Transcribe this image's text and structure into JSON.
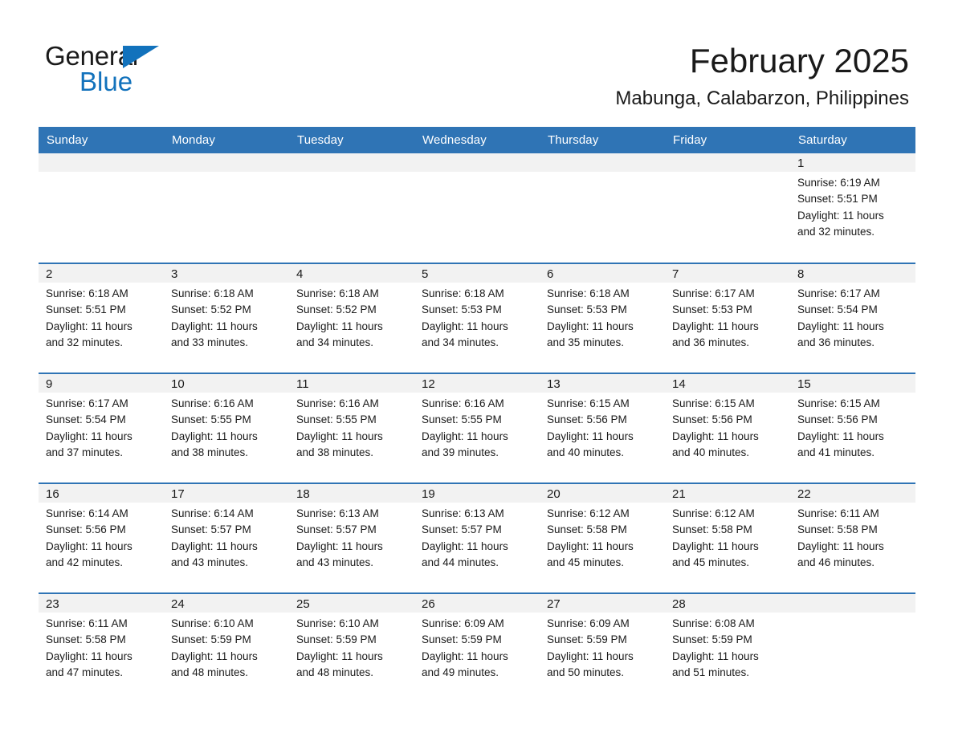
{
  "brand": {
    "word_one": "General",
    "word_two": "Blue",
    "accent_color": "#1272bc",
    "triangle_icon": "triangle-icon"
  },
  "header": {
    "title": "February 2025",
    "subtitle": "Mabunga, Calabarzon, Philippines"
  },
  "theme": {
    "header_blue": "#2f74b5",
    "daynum_band": "#f2f2f2",
    "text": "#1a1a1a"
  },
  "weekdays": [
    "Sunday",
    "Monday",
    "Tuesday",
    "Wednesday",
    "Thursday",
    "Friday",
    "Saturday"
  ],
  "weeks": [
    [
      {
        "day": "",
        "empty": true
      },
      {
        "day": "",
        "empty": true
      },
      {
        "day": "",
        "empty": true
      },
      {
        "day": "",
        "empty": true
      },
      {
        "day": "",
        "empty": true
      },
      {
        "day": "",
        "empty": true
      },
      {
        "day": "1",
        "sunrise": "Sunrise: 6:19 AM",
        "sunset": "Sunset: 5:51 PM",
        "daylight_line1": "Daylight: 11 hours",
        "daylight_line2": "and 32 minutes."
      }
    ],
    [
      {
        "day": "2",
        "sunrise": "Sunrise: 6:18 AM",
        "sunset": "Sunset: 5:51 PM",
        "daylight_line1": "Daylight: 11 hours",
        "daylight_line2": "and 32 minutes."
      },
      {
        "day": "3",
        "sunrise": "Sunrise: 6:18 AM",
        "sunset": "Sunset: 5:52 PM",
        "daylight_line1": "Daylight: 11 hours",
        "daylight_line2": "and 33 minutes."
      },
      {
        "day": "4",
        "sunrise": "Sunrise: 6:18 AM",
        "sunset": "Sunset: 5:52 PM",
        "daylight_line1": "Daylight: 11 hours",
        "daylight_line2": "and 34 minutes."
      },
      {
        "day": "5",
        "sunrise": "Sunrise: 6:18 AM",
        "sunset": "Sunset: 5:53 PM",
        "daylight_line1": "Daylight: 11 hours",
        "daylight_line2": "and 34 minutes."
      },
      {
        "day": "6",
        "sunrise": "Sunrise: 6:18 AM",
        "sunset": "Sunset: 5:53 PM",
        "daylight_line1": "Daylight: 11 hours",
        "daylight_line2": "and 35 minutes."
      },
      {
        "day": "7",
        "sunrise": "Sunrise: 6:17 AM",
        "sunset": "Sunset: 5:53 PM",
        "daylight_line1": "Daylight: 11 hours",
        "daylight_line2": "and 36 minutes."
      },
      {
        "day": "8",
        "sunrise": "Sunrise: 6:17 AM",
        "sunset": "Sunset: 5:54 PM",
        "daylight_line1": "Daylight: 11 hours",
        "daylight_line2": "and 36 minutes."
      }
    ],
    [
      {
        "day": "9",
        "sunrise": "Sunrise: 6:17 AM",
        "sunset": "Sunset: 5:54 PM",
        "daylight_line1": "Daylight: 11 hours",
        "daylight_line2": "and 37 minutes."
      },
      {
        "day": "10",
        "sunrise": "Sunrise: 6:16 AM",
        "sunset": "Sunset: 5:55 PM",
        "daylight_line1": "Daylight: 11 hours",
        "daylight_line2": "and 38 minutes."
      },
      {
        "day": "11",
        "sunrise": "Sunrise: 6:16 AM",
        "sunset": "Sunset: 5:55 PM",
        "daylight_line1": "Daylight: 11 hours",
        "daylight_line2": "and 38 minutes."
      },
      {
        "day": "12",
        "sunrise": "Sunrise: 6:16 AM",
        "sunset": "Sunset: 5:55 PM",
        "daylight_line1": "Daylight: 11 hours",
        "daylight_line2": "and 39 minutes."
      },
      {
        "day": "13",
        "sunrise": "Sunrise: 6:15 AM",
        "sunset": "Sunset: 5:56 PM",
        "daylight_line1": "Daylight: 11 hours",
        "daylight_line2": "and 40 minutes."
      },
      {
        "day": "14",
        "sunrise": "Sunrise: 6:15 AM",
        "sunset": "Sunset: 5:56 PM",
        "daylight_line1": "Daylight: 11 hours",
        "daylight_line2": "and 40 minutes."
      },
      {
        "day": "15",
        "sunrise": "Sunrise: 6:15 AM",
        "sunset": "Sunset: 5:56 PM",
        "daylight_line1": "Daylight: 11 hours",
        "daylight_line2": "and 41 minutes."
      }
    ],
    [
      {
        "day": "16",
        "sunrise": "Sunrise: 6:14 AM",
        "sunset": "Sunset: 5:56 PM",
        "daylight_line1": "Daylight: 11 hours",
        "daylight_line2": "and 42 minutes."
      },
      {
        "day": "17",
        "sunrise": "Sunrise: 6:14 AM",
        "sunset": "Sunset: 5:57 PM",
        "daylight_line1": "Daylight: 11 hours",
        "daylight_line2": "and 43 minutes."
      },
      {
        "day": "18",
        "sunrise": "Sunrise: 6:13 AM",
        "sunset": "Sunset: 5:57 PM",
        "daylight_line1": "Daylight: 11 hours",
        "daylight_line2": "and 43 minutes."
      },
      {
        "day": "19",
        "sunrise": "Sunrise: 6:13 AM",
        "sunset": "Sunset: 5:57 PM",
        "daylight_line1": "Daylight: 11 hours",
        "daylight_line2": "and 44 minutes."
      },
      {
        "day": "20",
        "sunrise": "Sunrise: 6:12 AM",
        "sunset": "Sunset: 5:58 PM",
        "daylight_line1": "Daylight: 11 hours",
        "daylight_line2": "and 45 minutes."
      },
      {
        "day": "21",
        "sunrise": "Sunrise: 6:12 AM",
        "sunset": "Sunset: 5:58 PM",
        "daylight_line1": "Daylight: 11 hours",
        "daylight_line2": "and 45 minutes."
      },
      {
        "day": "22",
        "sunrise": "Sunrise: 6:11 AM",
        "sunset": "Sunset: 5:58 PM",
        "daylight_line1": "Daylight: 11 hours",
        "daylight_line2": "and 46 minutes."
      }
    ],
    [
      {
        "day": "23",
        "sunrise": "Sunrise: 6:11 AM",
        "sunset": "Sunset: 5:58 PM",
        "daylight_line1": "Daylight: 11 hours",
        "daylight_line2": "and 47 minutes."
      },
      {
        "day": "24",
        "sunrise": "Sunrise: 6:10 AM",
        "sunset": "Sunset: 5:59 PM",
        "daylight_line1": "Daylight: 11 hours",
        "daylight_line2": "and 48 minutes."
      },
      {
        "day": "25",
        "sunrise": "Sunrise: 6:10 AM",
        "sunset": "Sunset: 5:59 PM",
        "daylight_line1": "Daylight: 11 hours",
        "daylight_line2": "and 48 minutes."
      },
      {
        "day": "26",
        "sunrise": "Sunrise: 6:09 AM",
        "sunset": "Sunset: 5:59 PM",
        "daylight_line1": "Daylight: 11 hours",
        "daylight_line2": "and 49 minutes."
      },
      {
        "day": "27",
        "sunrise": "Sunrise: 6:09 AM",
        "sunset": "Sunset: 5:59 PM",
        "daylight_line1": "Daylight: 11 hours",
        "daylight_line2": "and 50 minutes."
      },
      {
        "day": "28",
        "sunrise": "Sunrise: 6:08 AM",
        "sunset": "Sunset: 5:59 PM",
        "daylight_line1": "Daylight: 11 hours",
        "daylight_line2": "and 51 minutes."
      },
      {
        "day": "",
        "empty": true
      }
    ]
  ]
}
